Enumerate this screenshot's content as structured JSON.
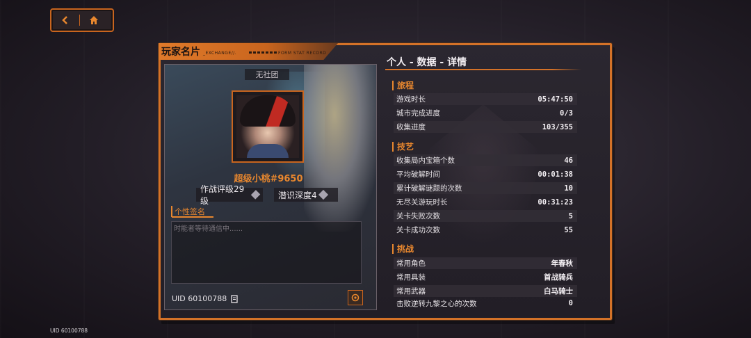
{
  "nav": {
    "back_icon": "chevron-left-icon",
    "home_icon": "home-icon"
  },
  "frame": {
    "title": "玩家名片",
    "sub_left": "_EXCHANGE//.",
    "sub_right": "FORM STAT RECORD"
  },
  "card": {
    "guild": "无社团",
    "nickname": "超级小桃#9650",
    "rank": "作战评级29级",
    "depth": "潜识深度4",
    "signature_label": "个性签名",
    "signature_placeholder": "时能者等待通信中......",
    "uid": "UID 60100788"
  },
  "detail": {
    "title": "个人 - 数据 - 详情",
    "sections": [
      {
        "name": "旅程",
        "rows": [
          {
            "k": "游戏时长",
            "v": "05:47:50"
          },
          {
            "k": "城市完成进度",
            "v": "0/3"
          },
          {
            "k": "收集进度",
            "v": "103/355"
          }
        ]
      },
      {
        "name": "技艺",
        "rows": [
          {
            "k": "收集局内宝箱个数",
            "v": "46"
          },
          {
            "k": "平均破解时间",
            "v": "00:01:38"
          },
          {
            "k": "累计破解谜题的次数",
            "v": "10"
          },
          {
            "k": "无尽关游玩时长",
            "v": "00:31:23"
          },
          {
            "k": "关卡失败次数",
            "v": "5"
          },
          {
            "k": "关卡成功次数",
            "v": "55"
          }
        ]
      },
      {
        "name": "挑战",
        "rows": [
          {
            "k": "常用角色",
            "v": "年春秋"
          },
          {
            "k": "常用具装",
            "v": "首战骑兵"
          },
          {
            "k": "常用武器",
            "v": "白马骑士"
          },
          {
            "k": "击败逆转九黎之心的次数",
            "v": "0"
          }
        ]
      }
    ]
  },
  "footer": {
    "uid": "UID 60100788"
  },
  "colors": {
    "accent": "#e8872e",
    "frame": "#d47228"
  }
}
